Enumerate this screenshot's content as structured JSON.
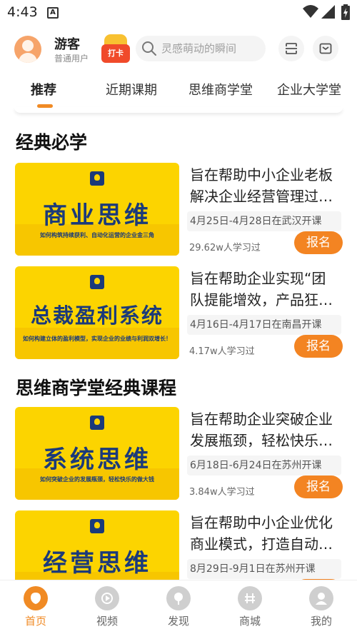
{
  "status_bar": {
    "time": "4:43",
    "notification_icon": "A"
  },
  "header": {
    "user_name": "游客",
    "user_role": "普通用户",
    "checkin_label": "打卡",
    "search_placeholder": "灵感萌动的瞬间"
  },
  "tabs": [
    {
      "label": "推荐",
      "active": true
    },
    {
      "label": "近期课期",
      "active": false
    },
    {
      "label": "思维商学堂",
      "active": false
    },
    {
      "label": "企业大学堂",
      "active": false
    }
  ],
  "sections": [
    {
      "title": "经典必学",
      "courses": [
        {
          "banner_title": "商业思维",
          "banner_subtitle": "如何构筑持续获利、自动化运营的企业金三角",
          "desc_line1": "旨在帮助中小企业老板",
          "desc_line2": "解决企业经营管理过…",
          "date": "4月25日-4月28日在武汉开课",
          "learners": "29.62w人学习过",
          "signup": "报名"
        },
        {
          "banner_title": "总裁盈利系统",
          "banner_subtitle": "如何构建立体的盈利模型，实现企业的业绩与利润双增长！",
          "desc_line1": "旨在帮助企业实现“团",
          "desc_line2": "队提能增效，产品狂…",
          "date": "4月16日-4月17日在南昌开课",
          "learners": "4.17w人学习过",
          "signup": "报名"
        }
      ]
    },
    {
      "title": "思维商学堂经典课程",
      "courses": [
        {
          "banner_title": "系统思维",
          "banner_subtitle": "如何突破企业的发展瓶颈，轻松快乐的做大钱",
          "desc_line1": "旨在帮助企业突破企业",
          "desc_line2": "发展瓶颈，轻松快乐…",
          "date": "6月18日-6月24日在苏州开课",
          "learners": "3.84w人学习过",
          "signup": "报名"
        },
        {
          "banner_title": "经营思维",
          "banner_subtitle": "",
          "desc_line1": "旨在帮助中小企业优化",
          "desc_line2": "商业模式，打造自动…",
          "date": "8月29日-9月1日在苏州开课",
          "learners": "",
          "signup": "报名"
        }
      ]
    }
  ],
  "bottom_nav": [
    {
      "label": "首页",
      "icon": "home-icon",
      "active": true
    },
    {
      "label": "视频",
      "icon": "video-icon",
      "active": false
    },
    {
      "label": "发现",
      "icon": "discover-icon",
      "active": false
    },
    {
      "label": "商城",
      "icon": "store-icon",
      "active": false
    },
    {
      "label": "我的",
      "icon": "profile-icon",
      "active": false
    }
  ],
  "colors": {
    "accent": "#f08a24",
    "banner_yellow": "#fcd400",
    "banner_text": "#1b3a7a"
  }
}
